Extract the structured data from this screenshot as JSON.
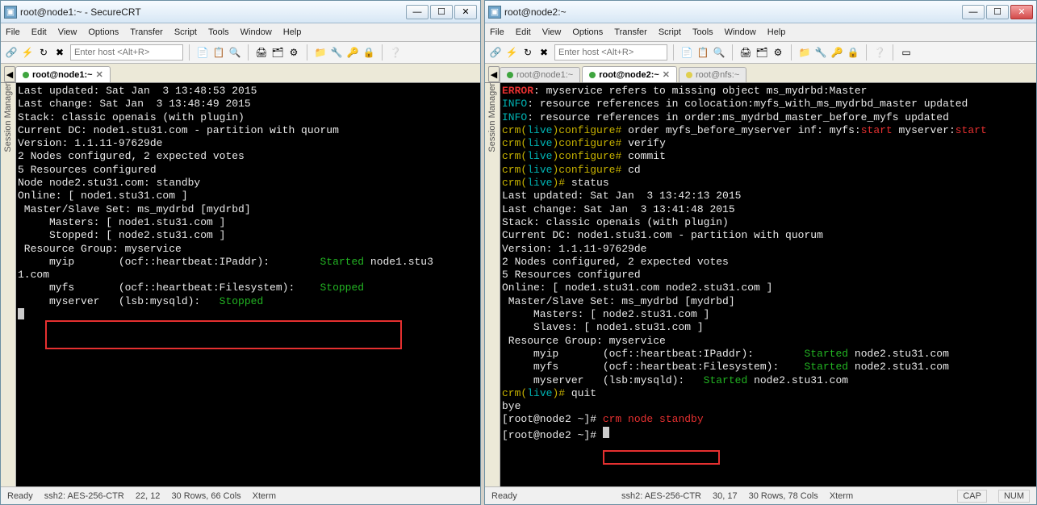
{
  "left": {
    "title": "root@node1:~ - SecureCRT",
    "menus": [
      "File",
      "Edit",
      "View",
      "Options",
      "Transfer",
      "Script",
      "Tools",
      "Window",
      "Help"
    ],
    "host_placeholder": "Enter host <Alt+R>",
    "tabs": [
      {
        "label": "root@node1:~",
        "active": true,
        "dot": "green"
      }
    ],
    "session_manager": "Session Manager",
    "term_lines": [
      [
        {
          "cls": "white",
          "t": "Last updated: Sat Jan  3 13:48:53 2015"
        }
      ],
      [
        {
          "cls": "white",
          "t": "Last change: Sat Jan  3 13:48:49 2015"
        }
      ],
      [
        {
          "cls": "white",
          "t": "Stack: classic openais (with plugin)"
        }
      ],
      [
        {
          "cls": "white",
          "t": "Current DC: node1.stu31.com - partition with quorum"
        }
      ],
      [
        {
          "cls": "white",
          "t": "Version: 1.1.11-97629de"
        }
      ],
      [
        {
          "cls": "white",
          "t": "2 Nodes configured, 2 expected votes"
        }
      ],
      [
        {
          "cls": "white",
          "t": "5 Resources configured"
        }
      ],
      [
        {
          "cls": "white",
          "t": ""
        }
      ],
      [
        {
          "cls": "white",
          "t": ""
        }
      ],
      [
        {
          "cls": "white",
          "t": "Node node2.stu31.com: standby"
        }
      ],
      [
        {
          "cls": "white",
          "t": "Online: [ node1.stu31.com ]"
        }
      ],
      [
        {
          "cls": "white",
          "t": ""
        }
      ],
      [
        {
          "cls": "white",
          "t": " Master/Slave Set: ms_mydrbd [mydrbd]"
        }
      ],
      [
        {
          "cls": "white",
          "t": "     Masters: [ node1.stu31.com ]"
        }
      ],
      [
        {
          "cls": "white",
          "t": "     Stopped: [ node2.stu31.com ]"
        }
      ],
      [
        {
          "cls": "white",
          "t": " Resource Group: myservice"
        }
      ],
      [
        {
          "cls": "white",
          "t": "     myip       (ocf::heartbeat:IPaddr):        "
        },
        {
          "cls": "green",
          "t": "Started "
        },
        {
          "cls": "white",
          "t": "node1.stu3"
        }
      ],
      [
        {
          "cls": "white",
          "t": "1.com"
        }
      ],
      [
        {
          "cls": "white",
          "t": "     myfs       (ocf::heartbeat:Filesystem):    "
        },
        {
          "cls": "green",
          "t": "Stopped"
        }
      ],
      [
        {
          "cls": "white",
          "t": "     myserver   (lsb:mysqld):   "
        },
        {
          "cls": "green",
          "t": "Stopped"
        }
      ],
      [
        {
          "cls": "white",
          "t": ""
        }
      ]
    ],
    "status": {
      "ready": "Ready",
      "proto": "ssh2: AES-256-CTR",
      "cursor": "22,  12",
      "size": "30 Rows, 66 Cols",
      "emul": "Xterm"
    }
  },
  "right": {
    "title": "root@node2:~",
    "menus": [
      "File",
      "Edit",
      "View",
      "Options",
      "Transfer",
      "Script",
      "Tools",
      "Window",
      "Help"
    ],
    "host_placeholder": "Enter host <Alt+R>",
    "tabs": [
      {
        "label": "root@node1:~",
        "active": false,
        "dot": "green"
      },
      {
        "label": "root@node2:~",
        "active": true,
        "dot": "green"
      },
      {
        "label": "root@nfs:~",
        "active": false,
        "dot": "yellow"
      }
    ],
    "session_manager": "Session Manager",
    "term_lines": [
      [
        {
          "cls": "redb",
          "t": "ERROR"
        },
        {
          "cls": "white",
          "t": ": myservice refers to missing object ms_mydrbd:Master"
        }
      ],
      [
        {
          "cls": "cyan",
          "t": "INFO"
        },
        {
          "cls": "white",
          "t": ": resource references in colocation:myfs_with_ms_mydrbd_master updated"
        }
      ],
      [
        {
          "cls": "cyan",
          "t": "INFO"
        },
        {
          "cls": "white",
          "t": ": resource references in order:ms_mydrbd_master_before_myfs updated"
        }
      ],
      [
        {
          "cls": "yellow",
          "t": "crm("
        },
        {
          "cls": "cyan",
          "t": "live"
        },
        {
          "cls": "yellow",
          "t": ")configure# "
        },
        {
          "cls": "white",
          "t": "order myfs_before_myserver inf: myfs:"
        },
        {
          "cls": "red",
          "t": "start"
        },
        {
          "cls": "white",
          "t": " myserver:"
        },
        {
          "cls": "red",
          "t": "start"
        }
      ],
      [
        {
          "cls": "yellow",
          "t": "crm("
        },
        {
          "cls": "cyan",
          "t": "live"
        },
        {
          "cls": "yellow",
          "t": ")configure# "
        },
        {
          "cls": "white",
          "t": "verify"
        }
      ],
      [
        {
          "cls": "yellow",
          "t": "crm("
        },
        {
          "cls": "cyan",
          "t": "live"
        },
        {
          "cls": "yellow",
          "t": ")configure# "
        },
        {
          "cls": "white",
          "t": "commit"
        }
      ],
      [
        {
          "cls": "yellow",
          "t": "crm("
        },
        {
          "cls": "cyan",
          "t": "live"
        },
        {
          "cls": "yellow",
          "t": ")configure# "
        },
        {
          "cls": "white",
          "t": "cd"
        }
      ],
      [
        {
          "cls": "yellow",
          "t": "crm("
        },
        {
          "cls": "cyan",
          "t": "live"
        },
        {
          "cls": "yellow",
          "t": ")# "
        },
        {
          "cls": "white",
          "t": "status"
        }
      ],
      [
        {
          "cls": "white",
          "t": "Last updated: Sat Jan  3 13:42:13 2015"
        }
      ],
      [
        {
          "cls": "white",
          "t": "Last change: Sat Jan  3 13:41:48 2015"
        }
      ],
      [
        {
          "cls": "white",
          "t": "Stack: classic openais (with plugin)"
        }
      ],
      [
        {
          "cls": "white",
          "t": "Current DC: node1.stu31.com - partition with quorum"
        }
      ],
      [
        {
          "cls": "white",
          "t": "Version: 1.1.11-97629de"
        }
      ],
      [
        {
          "cls": "white",
          "t": "2 Nodes configured, 2 expected votes"
        }
      ],
      [
        {
          "cls": "white",
          "t": "5 Resources configured"
        }
      ],
      [
        {
          "cls": "white",
          "t": ""
        }
      ],
      [
        {
          "cls": "white",
          "t": ""
        }
      ],
      [
        {
          "cls": "white",
          "t": "Online: [ node1.stu31.com node2.stu31.com ]"
        }
      ],
      [
        {
          "cls": "white",
          "t": ""
        }
      ],
      [
        {
          "cls": "white",
          "t": " Master/Slave Set: ms_mydrbd [mydrbd]"
        }
      ],
      [
        {
          "cls": "white",
          "t": "     Masters: [ node2.stu31.com ]"
        }
      ],
      [
        {
          "cls": "white",
          "t": "     Slaves: [ node1.stu31.com ]"
        }
      ],
      [
        {
          "cls": "white",
          "t": " Resource Group: myservice"
        }
      ],
      [
        {
          "cls": "white",
          "t": "     myip       (ocf::heartbeat:IPaddr):        "
        },
        {
          "cls": "green",
          "t": "Started "
        },
        {
          "cls": "white",
          "t": "node2.stu31.com"
        }
      ],
      [
        {
          "cls": "white",
          "t": "     myfs       (ocf::heartbeat:Filesystem):    "
        },
        {
          "cls": "green",
          "t": "Started "
        },
        {
          "cls": "white",
          "t": "node2.stu31.com"
        }
      ],
      [
        {
          "cls": "white",
          "t": "     myserver   (lsb:mysqld):   "
        },
        {
          "cls": "green",
          "t": "Started "
        },
        {
          "cls": "white",
          "t": "node2.stu31.com"
        }
      ],
      [
        {
          "cls": "yellow",
          "t": "crm("
        },
        {
          "cls": "cyan",
          "t": "live"
        },
        {
          "cls": "yellow",
          "t": ")# "
        },
        {
          "cls": "white",
          "t": "quit"
        }
      ],
      [
        {
          "cls": "white",
          "t": "bye"
        }
      ],
      [
        {
          "cls": "white",
          "t": "[root@node2 ~]# "
        },
        {
          "cls": "red",
          "t": "crm node standby"
        }
      ],
      [
        {
          "cls": "white",
          "t": "[root@node2 ~]# "
        }
      ]
    ],
    "status": {
      "ready": "Ready",
      "proto": "ssh2: AES-256-CTR",
      "cursor": "30,  17",
      "size": "30 Rows, 78 Cols",
      "emul": "Xterm",
      "cap": "CAP",
      "num": "NUM"
    }
  }
}
